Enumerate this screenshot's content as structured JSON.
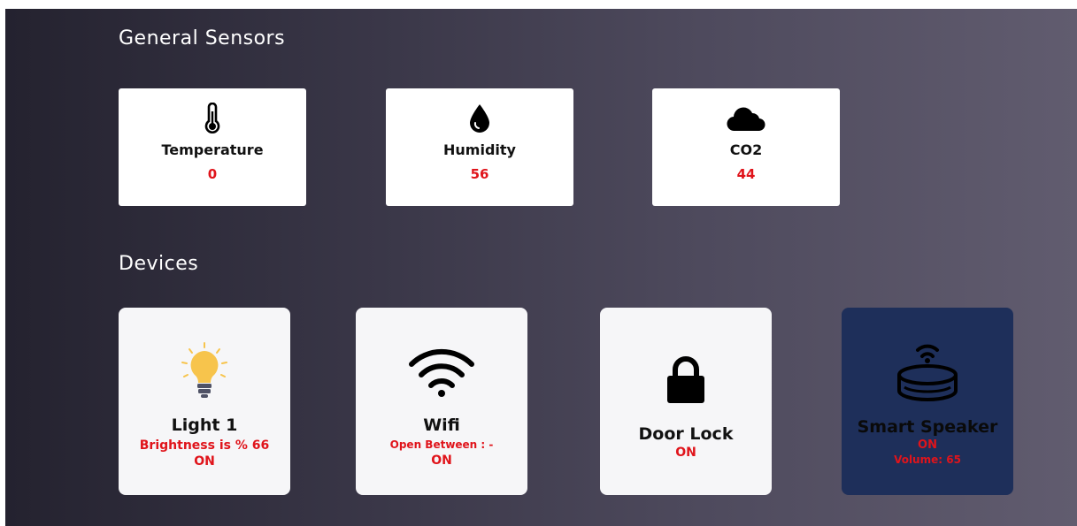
{
  "sections": {
    "sensors_title": "General Sensors",
    "devices_title": "Devices"
  },
  "sensors": [
    {
      "label": "Temperature",
      "value": "0",
      "icon": "thermometer-icon"
    },
    {
      "label": "Humidity",
      "value": "56",
      "icon": "droplet-icon"
    },
    {
      "label": "CO2",
      "value": "44",
      "icon": "cloud-icon"
    }
  ],
  "devices": {
    "light": {
      "name": "Light 1",
      "detail": "Brightness is % 66",
      "status": "ON",
      "icon": "light-bulb-icon"
    },
    "wifi": {
      "name": "Wifi",
      "detail": "Open Between : -",
      "status": "ON",
      "icon": "wifi-icon"
    },
    "lock": {
      "name": "Door Lock",
      "status": "ON",
      "icon": "lock-icon"
    },
    "speaker": {
      "name": "Smart Speaker",
      "status": "ON",
      "detail": "Volume: 65",
      "icon": "smart-speaker-icon"
    }
  },
  "colors": {
    "value_red": "#e0141b",
    "speaker_card_bg": "#1e2f5a",
    "bulb_yellow": "#f7c44c"
  }
}
